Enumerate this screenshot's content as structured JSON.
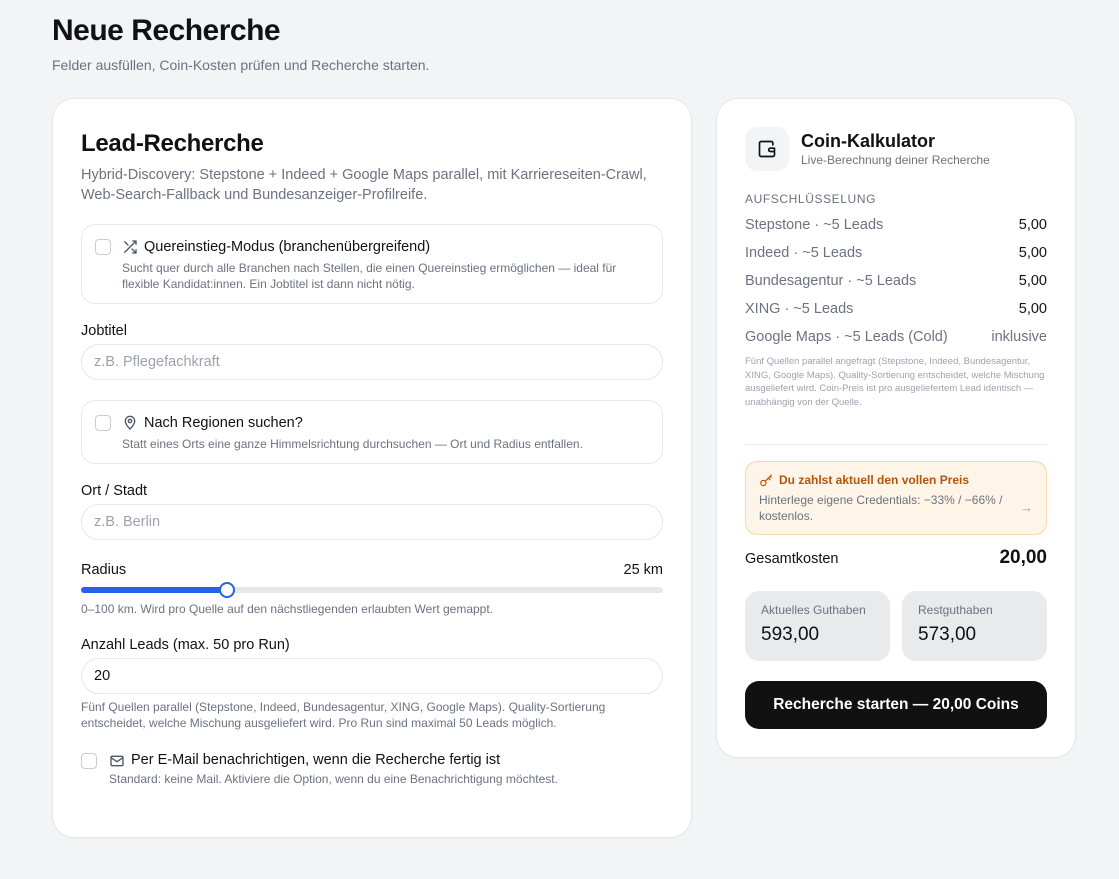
{
  "page": {
    "title": "Neue Recherche",
    "subtitle": "Felder ausfüllen, Coin-Kosten prüfen und Recherche starten."
  },
  "lead_form": {
    "title": "Lead-Recherche",
    "description": "Hybrid-Discovery: Stepstone + Indeed + Google Maps parallel, mit Karriereseiten-Crawl, Web-Search-Fallback und Bundesanzeiger-Profilreife.",
    "quereinstieg": {
      "checked": false,
      "icon": "shuffle-icon",
      "title": "Quereinstieg-Modus (branchenübergreifend)",
      "description": "Sucht quer durch alle Branchen nach Stellen, die einen Quereinstieg ermöglichen — ideal für flexible Kandidat:innen. Ein Jobtitel ist dann nicht nötig."
    },
    "jobtitle": {
      "label": "Jobtitel",
      "value": "",
      "placeholder": "z.B. Pflegefachkraft"
    },
    "regions": {
      "checked": false,
      "icon": "map-pin-icon",
      "title": "Nach Regionen suchen?",
      "description": "Statt eines Orts eine ganze Himmelsrichtung durchsuchen — Ort und Radius entfallen."
    },
    "city": {
      "label": "Ort / Stadt",
      "value": "",
      "placeholder": "z.B. Berlin"
    },
    "radius": {
      "label": "Radius",
      "value_text": "25 km",
      "value": 25,
      "min": 0,
      "max": 100,
      "hint": "0–100 km. Wird pro Quelle auf den nächstliegenden erlaubten Wert gemappt."
    },
    "leads": {
      "label": "Anzahl Leads (max. 50 pro Run)",
      "value": "20",
      "hint": "Fünf Quellen parallel (Stepstone, Indeed, Bundesagentur, XING, Google Maps). Quality-Sortierung entscheidet, welche Mischung ausgeliefert wird. Pro Run sind maximal 50 Leads möglich."
    },
    "email_notify": {
      "checked": false,
      "icon": "mail-icon",
      "title": "Per E-Mail benachrichtigen, wenn die Recherche fertig ist",
      "description": "Standard: keine Mail. Aktiviere die Option, wenn du eine Benachrichtigung möchtest."
    }
  },
  "calculator": {
    "icon": "wallet-icon",
    "title": "Coin-Kalkulator",
    "subtitle": "Live-Berechnung deiner Recherche",
    "section_label": "AUFSCHLÜSSELUNG",
    "items": [
      {
        "label": "Stepstone · ~5 Leads",
        "value": "5,00"
      },
      {
        "label": "Indeed · ~5 Leads",
        "value": "5,00"
      },
      {
        "label": "Bundesagentur · ~5 Leads",
        "value": "5,00"
      },
      {
        "label": "XING · ~5 Leads",
        "value": "5,00"
      },
      {
        "label": "Google Maps · ~5 Leads (Cold)",
        "value": "inklusive"
      }
    ],
    "note": "Fünf Quellen parallel angefragt (Stepstone, Indeed, Bundesagentur, XING, Google Maps). Quality-Sortierung entscheidet, welche Mischung ausgeliefert wird. Coin-Preis ist pro ausgeliefertem Lead identisch — unabhängig von der Quelle.",
    "promo": {
      "icon": "key-icon",
      "title": "Du zahlst aktuell den vollen Preis",
      "text": "Hinterlege eigene Credentials: −33% / −66% / kostenlos.",
      "arrow": "→"
    },
    "total_label": "Gesamtkosten",
    "total_value": "20,00",
    "current_balance_label": "Aktuelles Guthaben",
    "current_balance_value": "593,00",
    "remaining_label": "Restguthaben",
    "remaining_value": "573,00",
    "start_button": "Recherche starten — 20,00 Coins"
  },
  "colors": {
    "accent": "#2563eb",
    "background": "#f3f4f6",
    "button": "#111111",
    "promo_bg": "#fef5e8",
    "promo_text": "#b45309"
  }
}
